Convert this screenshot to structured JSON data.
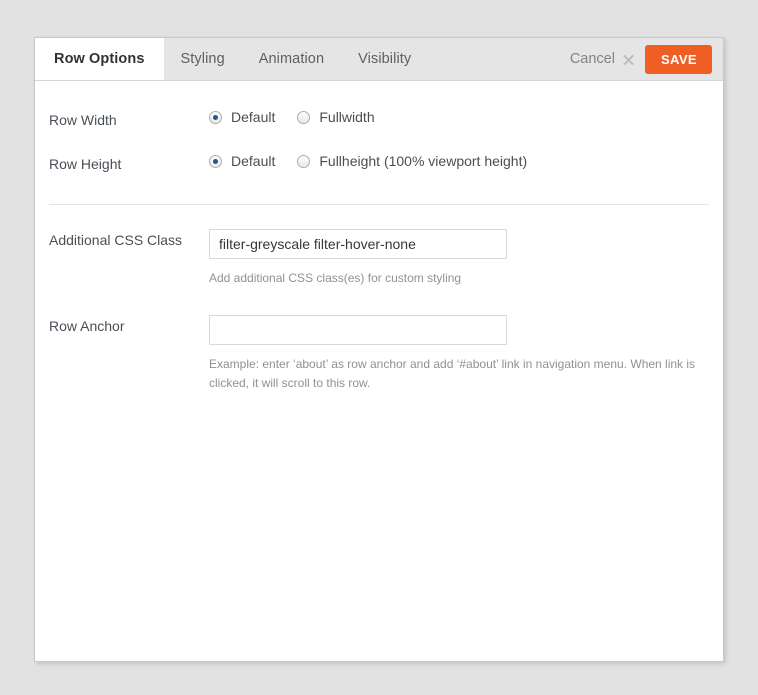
{
  "dialog": {
    "tabs": [
      {
        "label": "Row Options",
        "active": true
      },
      {
        "label": "Styling",
        "active": false
      },
      {
        "label": "Animation",
        "active": false
      },
      {
        "label": "Visibility",
        "active": false
      }
    ],
    "cancel_label": "Cancel",
    "cancel_icon": "close-x-icon",
    "save_label": "SAVE",
    "save_color": "#ef5e23",
    "resize_handle_icon": "resize-corner-icon",
    "resize_handle_glyph": "↘"
  },
  "fields": {
    "row_width": {
      "label": "Row Width",
      "options": [
        {
          "label": "Default",
          "selected": true
        },
        {
          "label": "Fullwidth",
          "selected": false
        }
      ]
    },
    "row_height": {
      "label": "Row Height",
      "options": [
        {
          "label": "Default",
          "selected": true
        },
        {
          "label": "Fullheight (100% viewport height)",
          "selected": false
        }
      ]
    },
    "css_class": {
      "label": "Additional CSS Class",
      "value": "filter-greyscale filter-hover-none",
      "placeholder": "",
      "help": "Add additional CSS class(es) for custom styling"
    },
    "row_anchor": {
      "label": "Row Anchor",
      "value": "",
      "placeholder": "",
      "help": "Example: enter ‘about’ as row anchor and add ‘#about’ link in navigation menu. When link is clicked, it will scroll to this row."
    }
  },
  "colors": {
    "accent": "#ef5e23",
    "radio_selected": "#1e5a8e",
    "page_background": "#e2e2e2"
  }
}
